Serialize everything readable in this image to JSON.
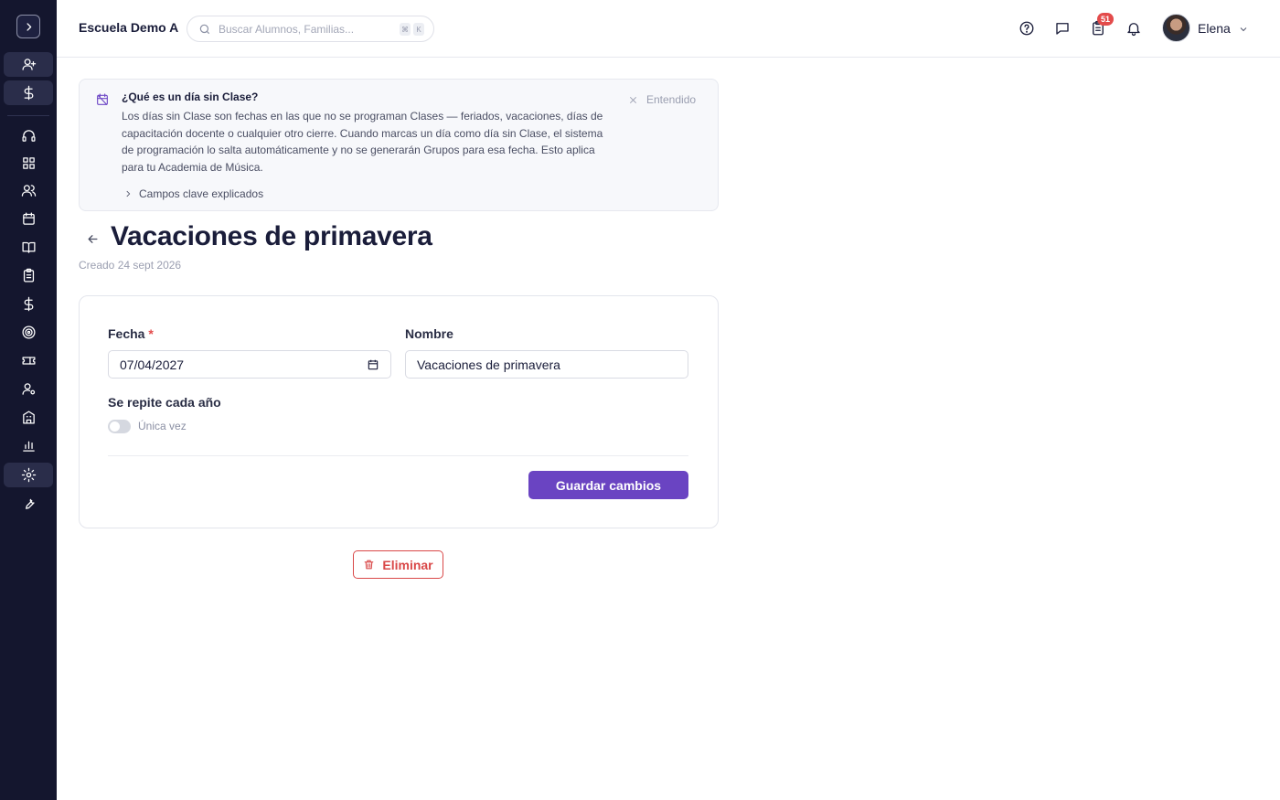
{
  "sidebar": {
    "toggle_icon": "chevron-right-icon",
    "items": [
      {
        "icon": "user-plus-icon",
        "active": true
      },
      {
        "icon": "dollar-icon",
        "active": true
      },
      {
        "icon": "headset-icon",
        "active": false
      },
      {
        "icon": "dashboard-icon",
        "active": false
      },
      {
        "icon": "users-icon",
        "active": false
      },
      {
        "icon": "calendar-icon",
        "active": false
      },
      {
        "icon": "book-icon",
        "active": false
      },
      {
        "icon": "clipboard-icon",
        "active": false
      },
      {
        "icon": "dollar-icon",
        "active": false
      },
      {
        "icon": "target-icon",
        "active": false
      },
      {
        "icon": "ticket-icon",
        "active": false
      },
      {
        "icon": "user-settings-icon",
        "active": false
      },
      {
        "icon": "building-icon",
        "active": false
      },
      {
        "icon": "bar-chart-icon",
        "active": false
      },
      {
        "icon": "gear-icon",
        "active": true
      },
      {
        "icon": "wrench-icon",
        "active": false
      }
    ]
  },
  "header": {
    "school_name": "Escuela Demo A",
    "search_placeholder": "Buscar Alumnos, Familias...",
    "search_shortcut_1": "⌘",
    "search_shortcut_2": "K",
    "tasks_badge": "51",
    "user_name": "Elena"
  },
  "banner": {
    "title": "¿Qué es un día sin Clase?",
    "body": "Los días sin Clase son fechas en las que no se programan Clases — feriados, vacaciones, días de capacitación docente o cualquier otro cierre. Cuando marcas un día como día sin Clase, el sistema de programación lo salta automáticamente y no se generarán Grupos para esa fecha. Esto aplica para tu Academia de Música.",
    "dismiss_label": "Entendido",
    "expand_label": "Campos clave explicados"
  },
  "page": {
    "title": "Vacaciones de primavera",
    "created": "Creado 24 sept 2026"
  },
  "form": {
    "date_label": "Fecha",
    "date_required_mark": "*",
    "date_value": "07/04/2027",
    "name_label": "Nombre",
    "name_value": "Vacaciones de primavera",
    "repeat_label": "Se repite cada año",
    "repeat_toggle_label": "Única vez",
    "repeat_on": false,
    "save_label": "Guardar cambios",
    "delete_label": "Eliminar"
  },
  "colors": {
    "sidebar_bg": "#14162e",
    "accent": "#6a44c2",
    "danger": "#d94848",
    "badge": "#e34b4b"
  }
}
